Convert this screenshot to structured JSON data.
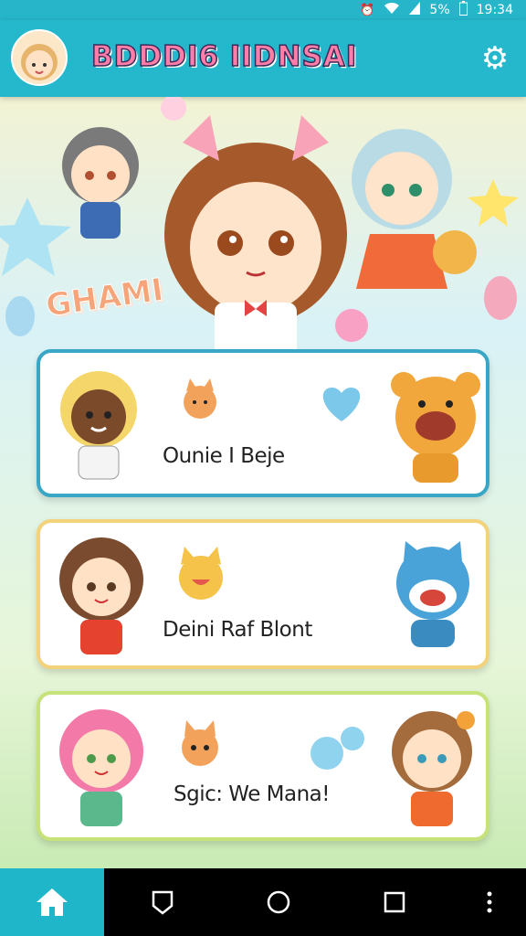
{
  "status_bar": {
    "battery": "5%",
    "time": "19:34"
  },
  "app_bar": {
    "title": "BDDDI6 IIDNSAI"
  },
  "hero": {
    "sticker_text": "GHAMI"
  },
  "cards": [
    {
      "label": "Ounie I Beje"
    },
    {
      "label": "Deini Raf Blont"
    },
    {
      "label": "Sgic: We Mana!"
    }
  ],
  "nav": {
    "home_icon": "home-icon",
    "back_icon": "back-icon",
    "circle_icon": "home-circle-icon",
    "recents_icon": "recents-icon",
    "more_icon": "more-icon"
  }
}
